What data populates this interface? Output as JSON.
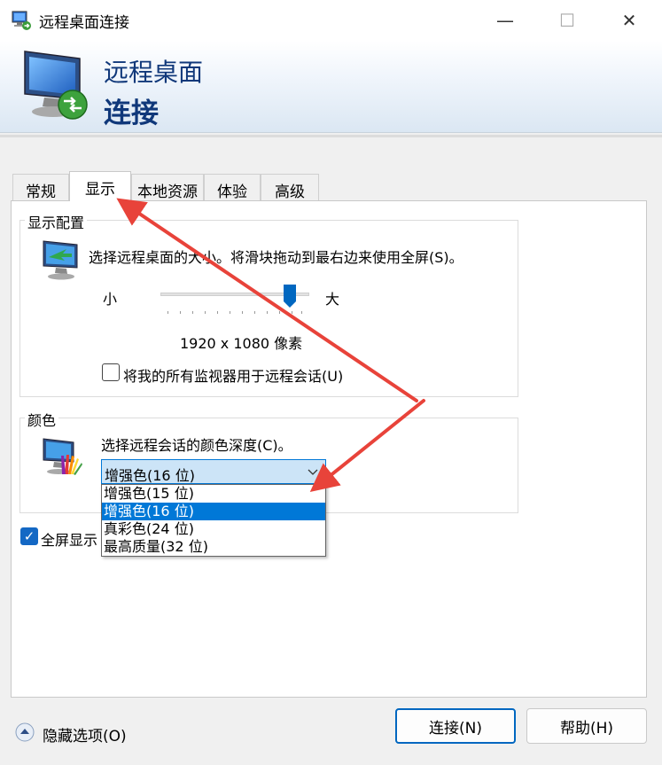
{
  "window": {
    "title": "远程桌面连接",
    "minimize_label": "—",
    "maximize_label": "☐",
    "close_label": "✕"
  },
  "banner": {
    "line1": "远程桌面",
    "line2": "连接"
  },
  "tabs": [
    {
      "label": "常规"
    },
    {
      "label": "显示"
    },
    {
      "label": "本地资源"
    },
    {
      "label": "体验"
    },
    {
      "label": "高级"
    }
  ],
  "display_config": {
    "group_title": "显示配置",
    "description": "选择远程桌面的大小。将滑块拖动到最右边来使用全屏(S)。",
    "slider_small": "小",
    "slider_large": "大",
    "resolution": "1920 x 1080 像素",
    "multi_monitor_label": "将我的所有监视器用于远程会话(U)",
    "multi_monitor_checked": false
  },
  "colors": {
    "group_title": "颜色",
    "description": "选择远程会话的颜色深度(C)。",
    "selected": "增强色(16 位)",
    "options": [
      "增强色(15 位)",
      "增强色(16 位)",
      "真彩色(24 位)",
      "最高质量(32 位)"
    ]
  },
  "fullscreen": {
    "label": "全屏显示",
    "checked": true,
    "check_mark": "✓"
  },
  "footer": {
    "hide_options": "隐藏选项(O)",
    "connect": "连接(N)",
    "help": "帮助(H)"
  },
  "accent": {
    "primary": "#0078d7",
    "banner_text": "#10387a",
    "arrow": "#e8433a"
  }
}
